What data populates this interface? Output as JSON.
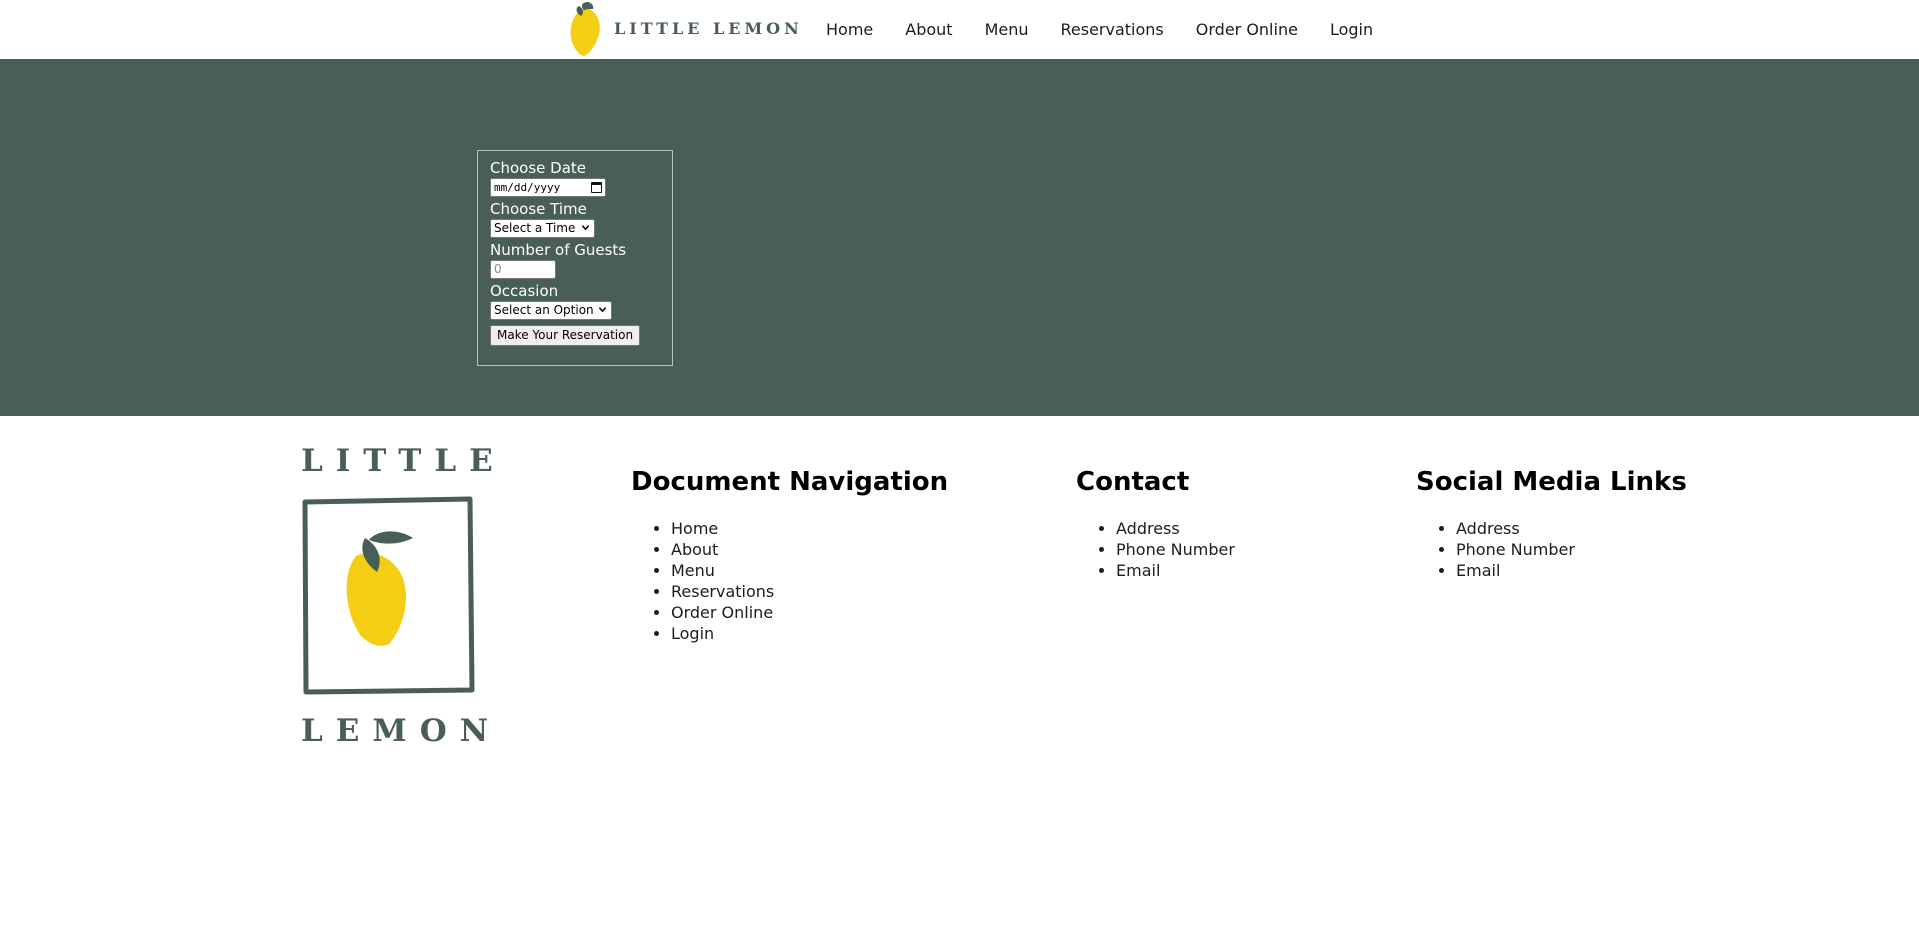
{
  "header": {
    "brand_text": "LITTLE LEMON",
    "nav": [
      "Home",
      "About",
      "Menu",
      "Reservations",
      "Order Online",
      "Login"
    ]
  },
  "reservation": {
    "date_label": "Choose Date",
    "date_placeholder": "mm/dd/yyyy",
    "time_label": "Choose Time",
    "time_selected": "Select a Time",
    "guests_label": "Number of Guests",
    "guests_value": "0",
    "occasion_label": "Occasion",
    "occasion_selected": "Select an Option",
    "submit_label": "Make Your Reservation"
  },
  "footer": {
    "logo_top": "LITTLE",
    "logo_bottom": "LEMON",
    "navigation": {
      "heading": "Document Navigation",
      "items": [
        "Home",
        "About",
        "Menu",
        "Reservations",
        "Order Online",
        "Login"
      ]
    },
    "contact": {
      "heading": "Contact",
      "items": [
        "Address",
        "Phone Number",
        "Email"
      ]
    },
    "social": {
      "heading": "Social Media Links",
      "items": [
        "Address",
        "Phone Number",
        "Email"
      ]
    }
  },
  "colors": {
    "brand_green": "#495e57",
    "lemon_yellow": "#f4ce14"
  },
  "icons": [
    "lemon-logo-icon",
    "calendar-icon",
    "chevron-down-icon"
  ]
}
